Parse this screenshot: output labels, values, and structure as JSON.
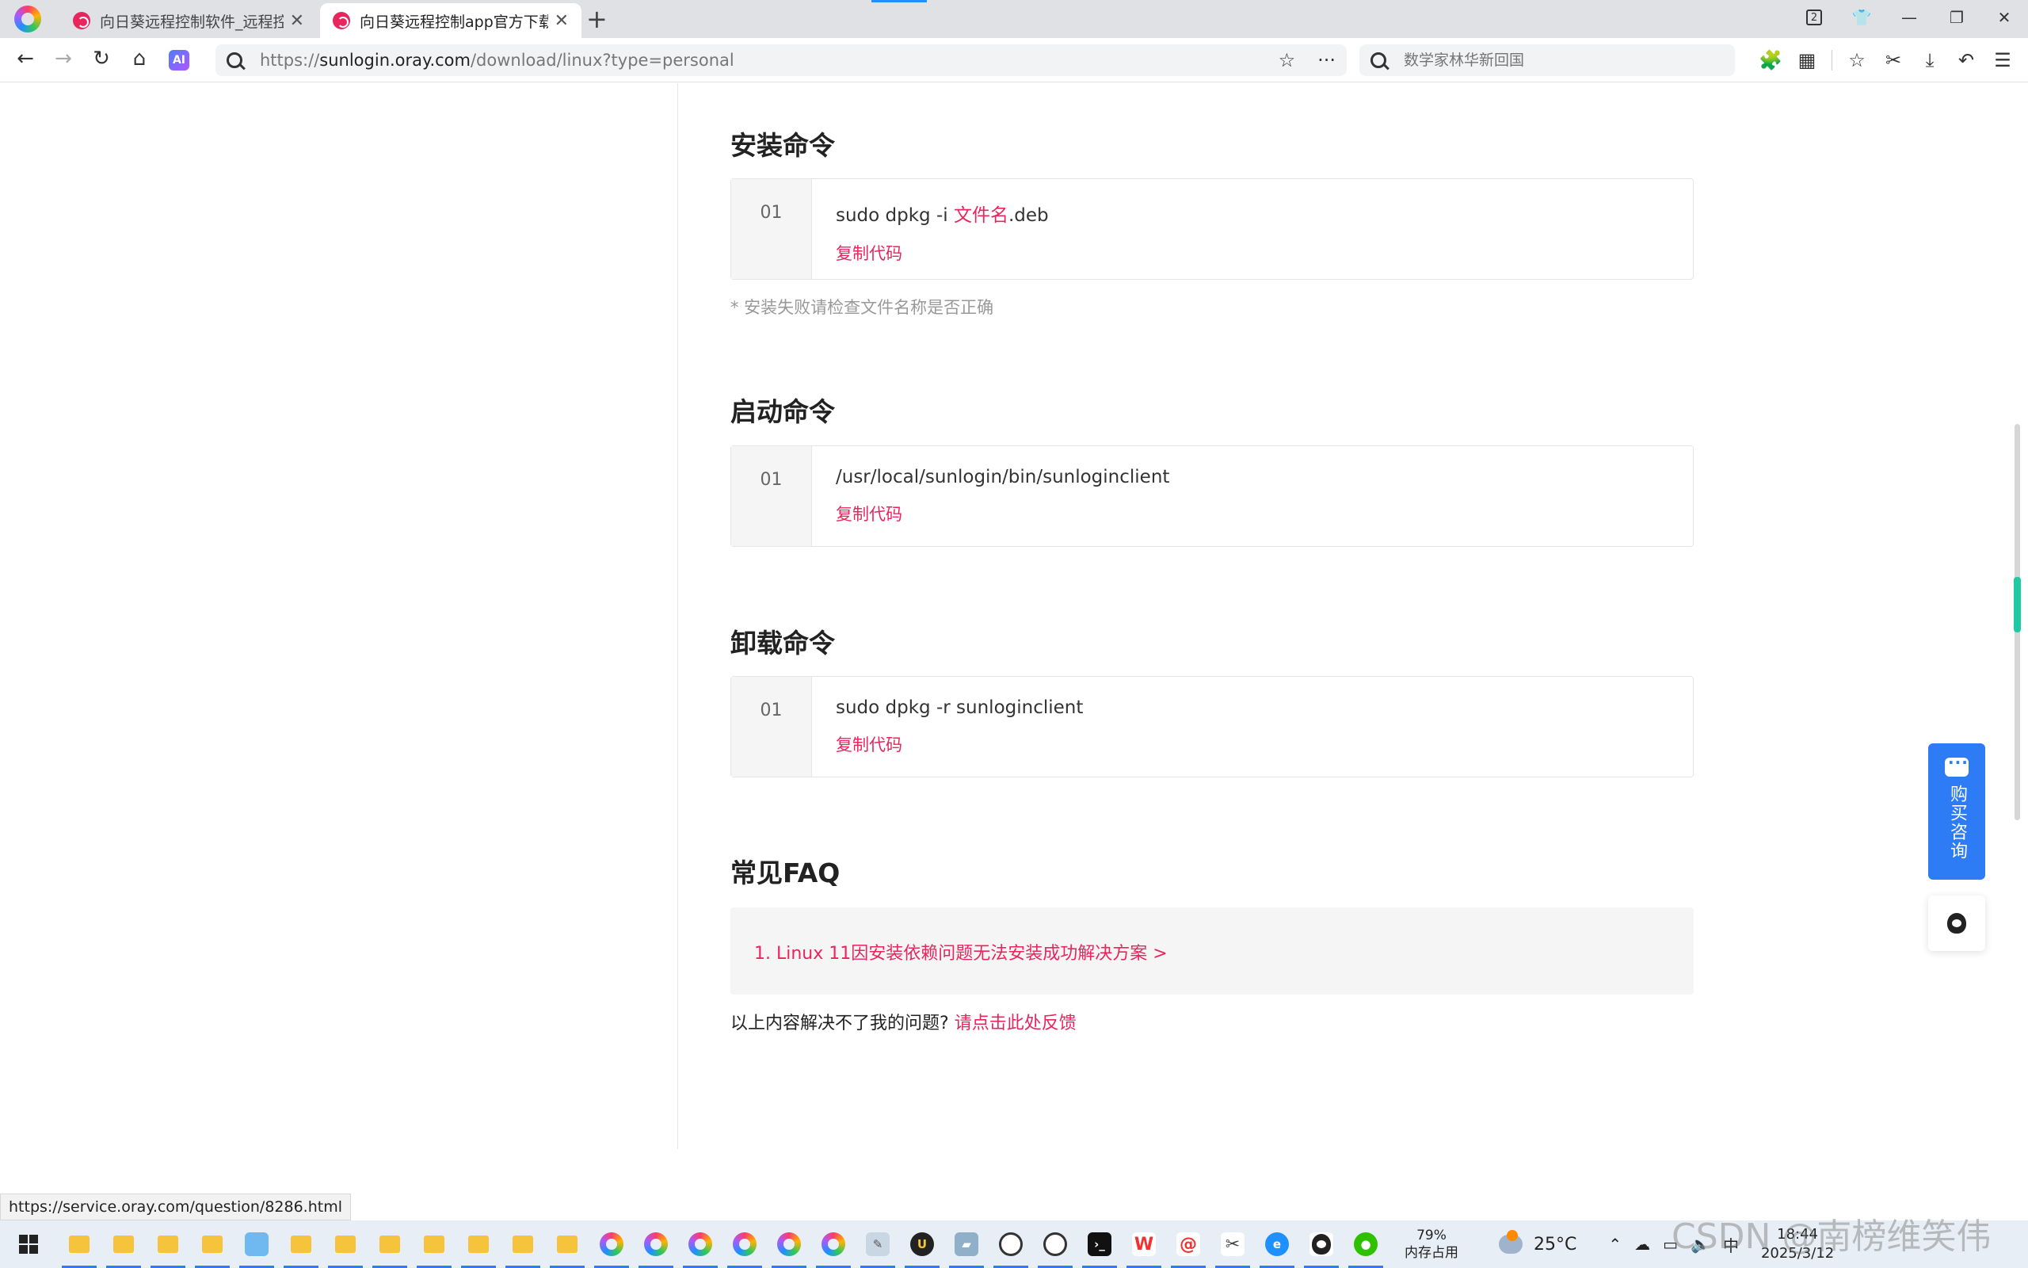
{
  "browser": {
    "tabs": [
      {
        "title": "向日葵远程控制软件_远程控制",
        "active": false
      },
      {
        "title": "向日葵远程控制app官方下载",
        "active": true
      }
    ],
    "new_tab_symbol": "+",
    "window": {
      "tab_count": "2"
    },
    "url": {
      "scheme": "https://",
      "host": "sunlogin.oray.com",
      "path": "/download/linux?type=personal"
    },
    "search_placeholder": "数学家林华新回国",
    "ai_label": "AI"
  },
  "page": {
    "install": {
      "title": "安装命令",
      "line": "01",
      "cmd_prefix": "sudo dpkg -i ",
      "cmd_highlight": "文件名",
      "cmd_suffix": ".deb",
      "copy": "复制代码",
      "note": "* 安装失败请检查文件名称是否正确"
    },
    "start": {
      "title": "启动命令",
      "line": "01",
      "cmd": "/usr/local/sunlogin/bin/sunloginclient",
      "copy": "复制代码"
    },
    "uninstall": {
      "title": "卸载命令",
      "line": "01",
      "cmd": "sudo dpkg -r sunloginclient",
      "copy": "复制代码"
    },
    "faq": {
      "title": "常见FAQ",
      "items": [
        "1. Linux 11因安装依赖问题无法安装成功解决方案 >"
      ],
      "footer_text": "以上内容解决不了我的问题?",
      "footer_link": "请点击此处反馈"
    },
    "float": {
      "consult": "购买咨询"
    },
    "status_url": "https://service.oray.com/question/8286.html"
  },
  "taskbar": {
    "memory_percent": "79%",
    "memory_label": "内存占用",
    "temperature": "25°C",
    "time": "18:44",
    "date": "2025/3/12",
    "watermark": "CSDN @南榜维笑伟"
  },
  "colors": {
    "accent": "#e8265e",
    "consult_blue": "#2d7cf6"
  }
}
